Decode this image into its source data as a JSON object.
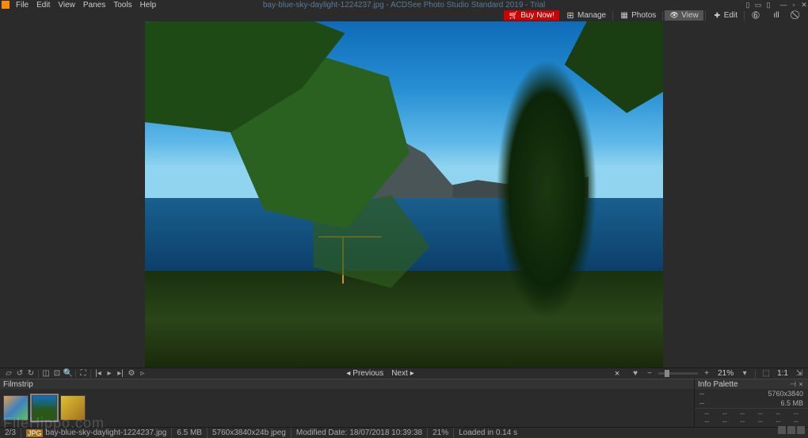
{
  "menubar": {
    "items": [
      "File",
      "Edit",
      "View",
      "Panes",
      "Tools",
      "Help"
    ],
    "title": "bay-blue-sky-daylight-1224237.jpg - ACDSee Photo Studio Standard 2019 - Trial"
  },
  "modes": {
    "buy": "Buy Now!",
    "manage": "Manage",
    "photos": "Photos",
    "view": "View",
    "edit": "Edit"
  },
  "nav": {
    "previous": "Previous",
    "next": "Next"
  },
  "zoom": {
    "value": "21%",
    "one_to_one": "1:1"
  },
  "filmstrip": {
    "title": "Filmstrip"
  },
  "info_palette": {
    "title": "Info Palette",
    "rows": [
      {
        "label": "--",
        "value": "5760x3840"
      },
      {
        "label": "--",
        "value": "6.5 MB"
      }
    ],
    "grid": [
      "--",
      "--",
      "--",
      "--",
      "--",
      "--",
      "--",
      "--",
      "--",
      "--",
      "--",
      "--"
    ]
  },
  "statusbar": {
    "position": "2/3",
    "format": "JPG",
    "filename": "bay-blue-sky-daylight-1224237.jpg",
    "filesize": "6.5 MB",
    "dimensions": "5760x3840x24b jpeg",
    "modified_label": "Modified Date:",
    "modified_value": "18/07/2018 10:39:38",
    "zoom": "21%",
    "loaded": "Loaded in 0.14 s"
  },
  "watermark": "FileHippo.com"
}
